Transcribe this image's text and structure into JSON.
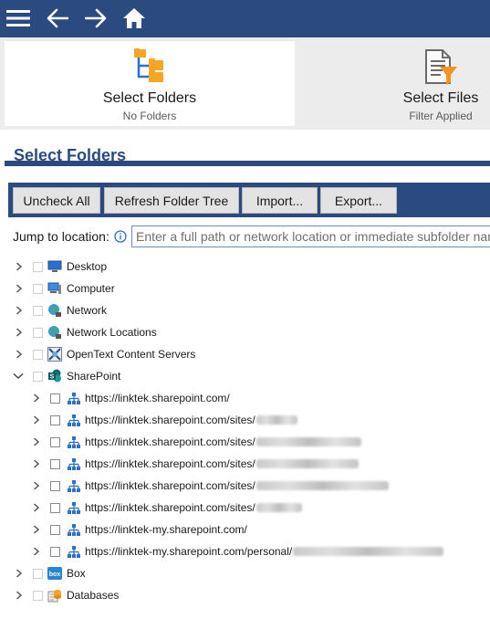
{
  "topbar": {
    "icons": [
      "hamburger-menu-icon",
      "back-arrow-icon",
      "forward-arrow-icon",
      "home-icon"
    ],
    "color": "#2b4a80"
  },
  "tabs": [
    {
      "title": "Select Folders",
      "subtitle": "No Folders",
      "icon": "folder-tree-icon"
    },
    {
      "title": "Select Files",
      "subtitle": "Filter Applied",
      "icon": "file-filter-icon"
    }
  ],
  "section_title": "Select Folders",
  "toolbar": {
    "uncheck_all": "Uncheck All",
    "refresh": "Refresh Folder Tree",
    "import": "Import...",
    "export": "Export..."
  },
  "jump": {
    "label": "Jump to location:",
    "placeholder": "Enter a full path or network location or immediate subfolder nam"
  },
  "tree": {
    "desktop": "Desktop",
    "computer": "Computer",
    "network": "Network",
    "network_locations": "Network Locations",
    "opentext": "OpenText Content Servers",
    "sharepoint": "SharePoint",
    "sp_root": "https://linktek.sharepoint.com/",
    "sp_sites": "https://linktek.sharepoint.com/sites/",
    "sp_my": "https://linktek-my.sharepoint.com/",
    "sp_personal": "https://linktek-my.sharepoint.com/personal/",
    "box": "Box",
    "databases": "Databases"
  }
}
